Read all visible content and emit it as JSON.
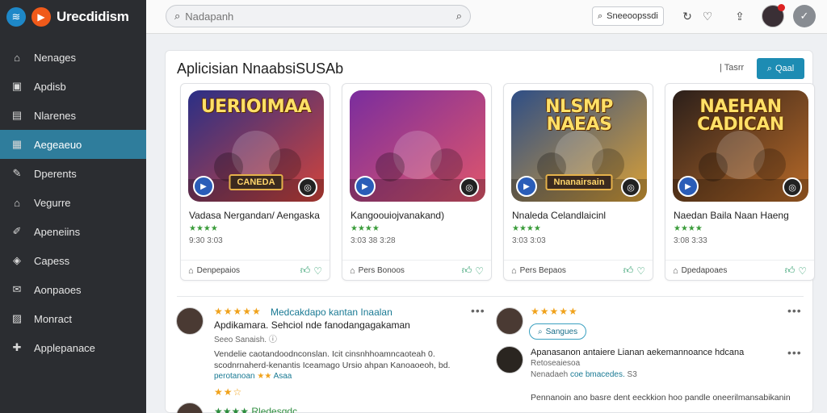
{
  "app": {
    "name": "Urecdidism"
  },
  "sidebar": {
    "items": [
      {
        "label": "Nenages",
        "icon": "home-icon",
        "glyph": "⌂"
      },
      {
        "label": "Apdisb",
        "icon": "apps-icon",
        "glyph": "▣"
      },
      {
        "label": "Nlarenes",
        "icon": "list-icon",
        "glyph": "▤"
      },
      {
        "label": "Aegeaeuo",
        "icon": "store-icon",
        "glyph": "▦",
        "active": true
      },
      {
        "label": "Dperents",
        "icon": "wrench-icon",
        "glyph": "✎"
      },
      {
        "label": "Vegurre",
        "icon": "house-icon",
        "glyph": "⌂"
      },
      {
        "label": "Apeneiins",
        "icon": "edit-icon",
        "glyph": "✐"
      },
      {
        "label": "Capess",
        "icon": "tag-icon",
        "glyph": "◈"
      },
      {
        "label": "Aonpaoes",
        "icon": "mail-icon",
        "glyph": "✉"
      },
      {
        "label": "Monract",
        "icon": "grid-icon",
        "glyph": "▨"
      },
      {
        "label": "Applepanace",
        "icon": "puzzle-icon",
        "glyph": "✚"
      }
    ]
  },
  "topbar": {
    "search_placeholder": "Nadapanh",
    "pill_button": "Sneeoopssdi",
    "icons": [
      "search-icon",
      "heart-icon",
      "share-icon"
    ]
  },
  "main": {
    "title": "Aplicisian NnaabsiSUSAb",
    "filter_label": "Tasrr",
    "primary_button": "Qaal",
    "apps": [
      {
        "thumb_title": "UERIOIMAA",
        "thumb_banner": "CANEDA",
        "name": "Vadasa Nergandan/ Aengaska",
        "stars": "★★★★",
        "meta": "9:30 3:03",
        "category": "Denpepaios",
        "bg1": "#2a2f86",
        "bg2": "#d2443b"
      },
      {
        "thumb_title": "",
        "thumb_banner": "",
        "name": "Kangoouiojvanakand)",
        "stars": "★★★★",
        "meta": "3:03 38 3:28",
        "category": "Pers Bonoos",
        "bg1": "#7a2d9e",
        "bg2": "#e0566b"
      },
      {
        "thumb_title": "NLSMP NAEAS",
        "thumb_banner": "Nnanairsain",
        "name": "Nnaleda Celandlaicinl",
        "stars": "★★★★",
        "meta": "3:03 3:03",
        "category": "Pers Bepaos",
        "bg1": "#2e4e86",
        "bg2": "#d9a037"
      },
      {
        "thumb_title": "NAEHAN CADICAN",
        "thumb_banner": "",
        "name": "Naedan Baila Naan Haeng",
        "stars": "★★★★",
        "meta": "3:08 3:33",
        "category": "Dpedapoaes",
        "bg1": "#2b1f1a",
        "bg2": "#b86a28"
      }
    ]
  },
  "reviews": [
    {
      "stars": "★★★★★",
      "title": "Medcakdapo kantan Inaalan",
      "subtitle": "Apdikamara. Sehciol nde fanodangagakaman",
      "meta": "Seeo Sanaish.",
      "body": "Vendelie caotandoodnconslan. Icit cinsnhhoamncaoteah 0. scodnrnaherd-kenantis Iceamago Ursio ahpan Kanoaoeoh, bd.",
      "link": "perotanoan",
      "link_tag": "Asaa"
    },
    {
      "stars": "★★★★★",
      "pill": "Sangues"
    },
    {
      "title": "Apanasanon antaiere Lianan aekemannoance hdcana",
      "subtitle": "Retoseaiesoa",
      "meta": "Nenadaeh",
      "link": "coe bmacedes.",
      "meta2": "S3",
      "body": "Pennanoin ano basre dent eeckkion hoo pandle oneerilmansabikanin"
    }
  ],
  "colors": {
    "accent": "#1d8cb3",
    "sidebar": "#2b2d31",
    "active": "#2f7d9c"
  }
}
